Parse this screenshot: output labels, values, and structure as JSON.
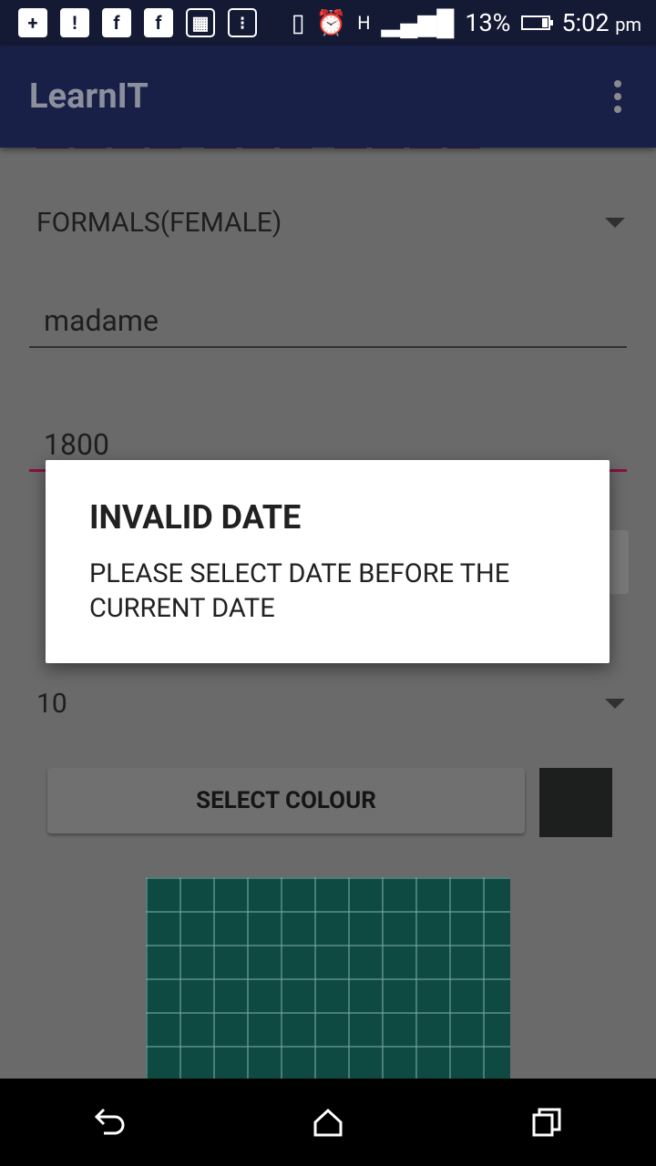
{
  "status_bar": {
    "battery": "13%",
    "time": "5:02",
    "ampm": "pm",
    "network": "H",
    "icons": [
      "add-box-icon",
      "alert-icon",
      "facebook-icon",
      "facebook-icon",
      "gallery-icon",
      "calculator-icon",
      "vibrate-icon",
      "alarm-icon",
      "network-h-icon",
      "signal-icon",
      "battery-icon"
    ]
  },
  "app_bar": {
    "title": "LearnIT"
  },
  "form": {
    "category_spinner": "FORMALS(FEMALE)",
    "brand_field": "madame",
    "price_field": "1800",
    "quantity_spinner": "10",
    "select_colour_label": "SELECT COLOUR",
    "selected_colour": "#1d1f1f"
  },
  "dialog": {
    "title": "INVALID DATE",
    "message": "PLEASE SELECT DATE BEFORE THE CURRENT DATE"
  },
  "colors": {
    "app_bar": "#192048",
    "status_bar": "#141a33",
    "accent": "#8a1040",
    "scrim_background": "#6a6a6a"
  }
}
